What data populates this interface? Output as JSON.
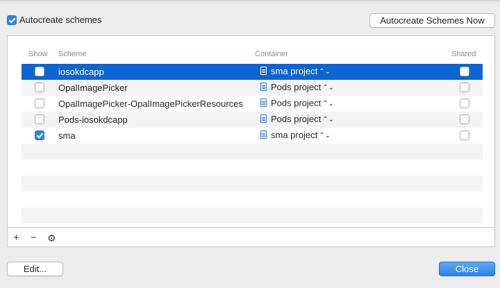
{
  "autocreate": {
    "label": "Autocreate schemes",
    "checked": true
  },
  "buttons": {
    "autocreate_now": "Autocreate Schemes Now",
    "edit": "Edit...",
    "close": "Close"
  },
  "table": {
    "headers": {
      "show": "Show",
      "scheme": "Scheme",
      "container": "Container",
      "shared": "Shared"
    },
    "rows": [
      {
        "scheme": "iosokdcapp",
        "container": "sma project",
        "show": false,
        "shared": false,
        "selected": true
      },
      {
        "scheme": "OpalImagePicker",
        "container": "Pods project",
        "show": false,
        "shared": false,
        "selected": false
      },
      {
        "scheme": "OpalImagePicker-OpalImagePickerResources",
        "container": "Pods project",
        "show": false,
        "shared": false,
        "selected": false
      },
      {
        "scheme": "Pods-iosokdcapp",
        "container": "Pods project",
        "show": false,
        "shared": false,
        "selected": false
      },
      {
        "scheme": "sma",
        "container": "sma project",
        "show": true,
        "shared": false,
        "selected": false
      }
    ]
  },
  "toolbar": {
    "add": "+",
    "remove": "−",
    "gear_icon": "gear-icon"
  },
  "colors": {
    "accent": "#0d64d3",
    "close_button": "#2a83ea"
  }
}
